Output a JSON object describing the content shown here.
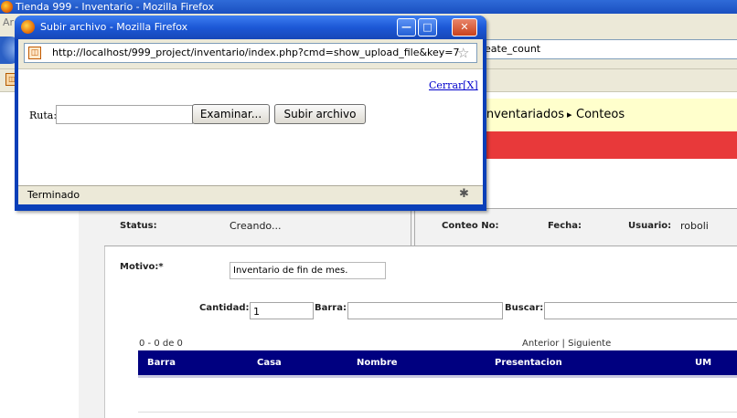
{
  "browser": {
    "window_title": "Tienda 999 - Inventario - Mozilla Firefox",
    "menu_fragment": "Ar",
    "url_fragment": "eate_count",
    "bookmark_icon": "page-icon"
  },
  "page": {
    "breadcrumb": {
      "inventariados": "Inventariados",
      "separator": "▸",
      "conteos": "Conteos"
    },
    "info": {
      "status_label": "Status:",
      "status_value": "Creando...",
      "conteo_label": "Conteo No:",
      "fecha_label": "Fecha:",
      "usuario_label": "Usuario:",
      "usuario_value": "roboli"
    },
    "motivo": {
      "label": "Motivo:*",
      "value": "Inventario de fin de mes."
    },
    "fields": {
      "cantidad_label": "Cantidad:",
      "cantidad_value": "1",
      "barra_label": "Barra:",
      "buscar_label": "Buscar:"
    },
    "pager": {
      "count": "0 - 0 de 0",
      "links": "Anterior | Siguiente"
    },
    "table": {
      "columns": [
        "Barra",
        "Casa",
        "Nombre",
        "Presentacion",
        "UM"
      ]
    }
  },
  "popup": {
    "title": "Subir archivo - Mozilla Firefox",
    "url": "http://localhost/999_project/inventario/index.php?cmd=show_upload_file&key=7",
    "close_link": "Cerrar[X]",
    "ruta_label": "Ruta:",
    "browse_button": "Examinar...",
    "upload_button": "Subir archivo",
    "status": "Terminado",
    "window_buttons": {
      "minimize": "—",
      "maximize": "□",
      "close": "✕"
    }
  },
  "colors": {
    "table_header": "#000080",
    "breadcrumb_bg": "#ffffcc",
    "red_bar": "#e8393a",
    "titlebar": "#1c58d6"
  }
}
